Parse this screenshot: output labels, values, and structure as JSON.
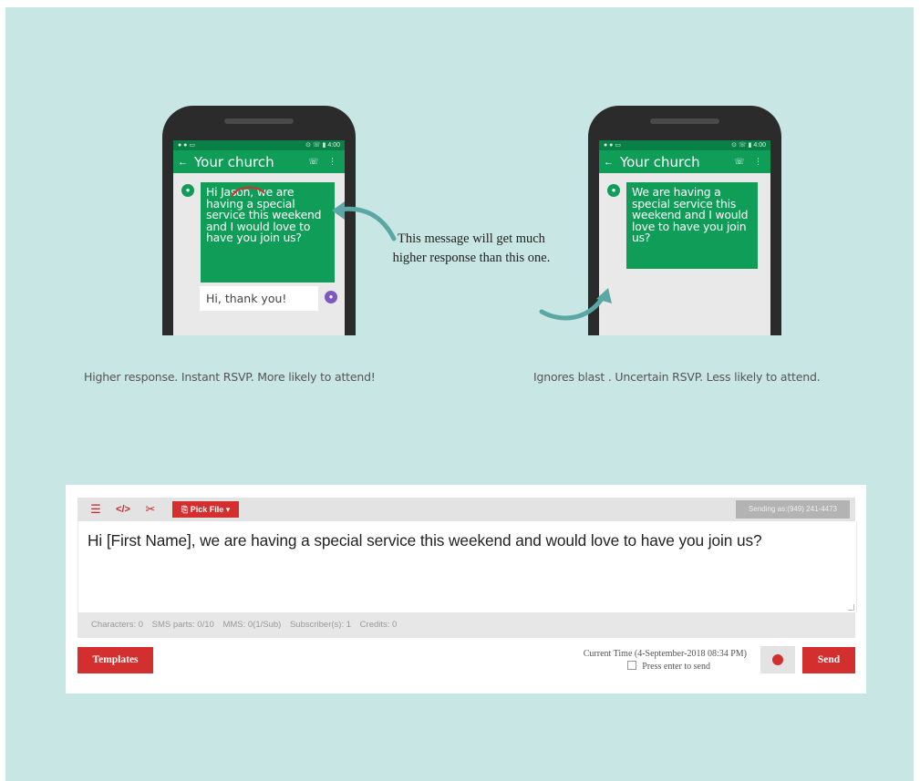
{
  "colors": {
    "background": "#c8e6e3",
    "accent_green": "#0f9d58",
    "accent_red": "#d32f2f"
  },
  "phone_left": {
    "status_left": "● ● ▭",
    "status_right": "⊙ ☏ ▮ 4:00",
    "title": "Your church",
    "message": "Hi Jason, we are having a special service this weekend and I would love to have you join us?",
    "reply": "Hi, thank you!"
  },
  "phone_right": {
    "status_left": "● ● ▭",
    "status_right": "⊙ ☏ ▮ 4:00",
    "title": "Your church",
    "message": "We are having a special service this weekend and I would love to have you join us?"
  },
  "center_note": "This message will get much higher response than this one.",
  "caption_left": "Higher response. Instant RSVP. More likely to attend!",
  "caption_right": "Ignores blast . Uncertain RSVP. Less likely to attend.",
  "composer": {
    "pick_file": "Pick File",
    "sending_as": "Sending as:(949) 241-4473",
    "message": "Hi [First Name], we are having a special service this weekend and would love to have you join us?",
    "stats": [
      "Characters: 0",
      "SMS parts: 0/10",
      "MMS: 0(1/Sub)",
      "Subscriber(s): 1",
      "Credits: 0"
    ],
    "templates": "Templates",
    "current_time": "Current Time (4-September-2018 08:34 PM)",
    "press_enter": "Press enter to send",
    "send": "Send"
  },
  "icons": [
    "layout-icon",
    "code-icon",
    "tools-icon",
    "file-icon",
    "chevron-down-icon",
    "clock-icon",
    "back-arrow-icon",
    "phone-icon",
    "more-icon",
    "person-icon"
  ]
}
